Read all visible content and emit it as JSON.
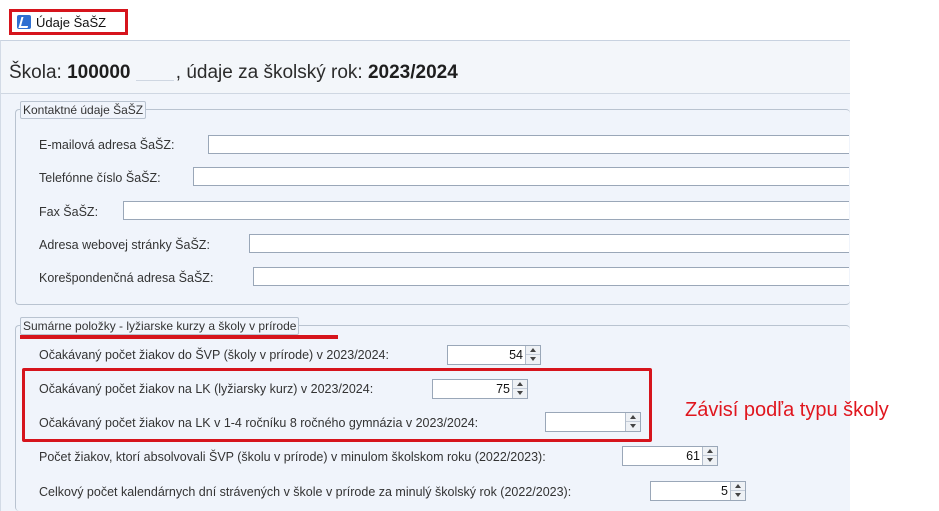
{
  "tab": {
    "title": "Údaje ŠaŠZ",
    "icon": "app-icon"
  },
  "header": {
    "school_prefix": "Škola:",
    "school_code": "100000",
    "year_prefix": ", údaje za školský rok:",
    "year": "2023/2024"
  },
  "contact_group": {
    "legend": "Kontaktné údaje ŠaŠZ",
    "fields": [
      {
        "label": "E-mailová adresa ŠaŠZ:",
        "value": ""
      },
      {
        "label": "Telefónne číslo ŠaŠZ:",
        "value": ""
      },
      {
        "label": "Fax ŠaŠZ:",
        "value": ""
      },
      {
        "label": "Adresa webovej stránky ŠaŠZ:",
        "value": ""
      },
      {
        "label": "Korešpondenčná adresa ŠaŠZ:",
        "value": ""
      }
    ]
  },
  "summary_group": {
    "legend": "Sumárne položky - lyžiarske kurzy a školy v prírode",
    "fields": [
      {
        "label": "Očakávaný počet žiakov do ŠVP (školy v prírode) v 2023/2024:",
        "value": "54"
      },
      {
        "label": "Očakávaný počet žiakov na LK (lyžiarsky kurz) v 2023/2024:",
        "value": "75"
      },
      {
        "label": "Očakávaný počet žiakov na LK v 1-4 ročníku 8 ročného gymnázia v 2023/2024:",
        "value": ""
      },
      {
        "label": "Počet žiakov, ktorí absolvovali ŠVP (školu v prírode) v minulom školskom roku (2022/2023):",
        "value": "61"
      },
      {
        "label": "Celkový počet kalendárnych dní strávených v škole v prírode za minulý školský rok (2022/2023):",
        "value": "5"
      }
    ]
  },
  "annotation": {
    "text": "Závisí podľa typu školy",
    "color": "#e0161e"
  },
  "colors": {
    "highlight": "#d6141c",
    "window_bg": "#f0f4fb"
  }
}
